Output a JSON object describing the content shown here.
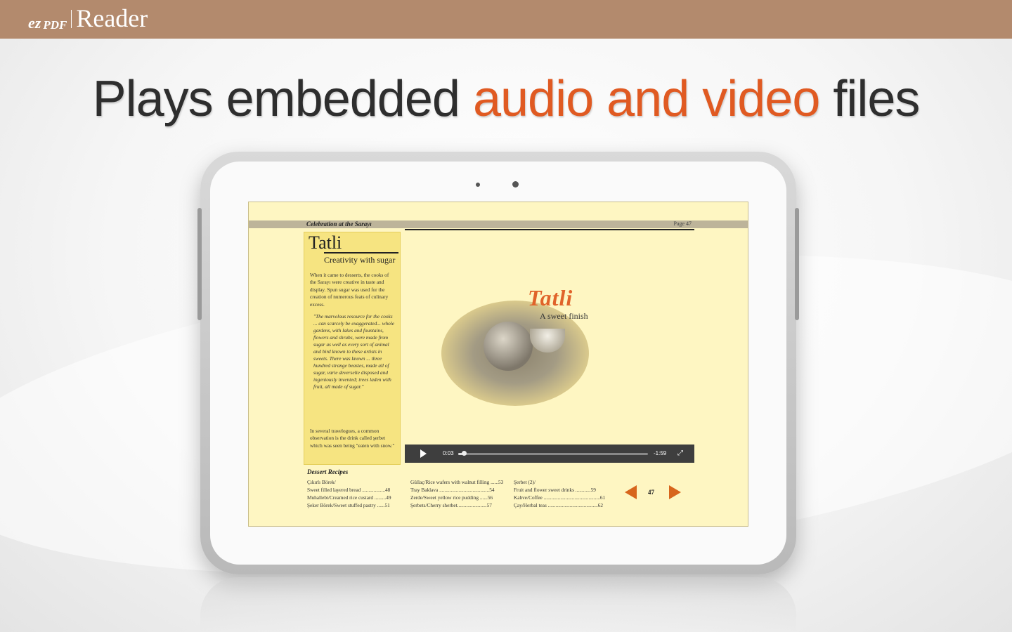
{
  "brand": {
    "ez": "ez",
    "pdf": "PDF",
    "reader": "Reader"
  },
  "headline": {
    "part1": "Plays embedded ",
    "accent": "audio and video",
    "part2": " files"
  },
  "colors": {
    "topbar": "#b38a6d",
    "accent": "#e05a22",
    "screen_bg": "#fef6c2"
  },
  "document": {
    "header_title": "Celebration at the Sarayı",
    "header_page": "Page 47",
    "panel": {
      "title": "Tatli",
      "subtitle": "Creativity with sugar",
      "intro": "When it came to desserts, the cooks of the Sarayı were creative in taste and display. Spun sugar was used for the creation of numerous feats of culinary excess.",
      "quote": "\"The marvelous resource for the cooks ... can scarcely be exaggerated... whole gardens, with lakes and fountains, flowers and shrubs, were made from sugar as well as every sort of animal and bird known to these artists in sweets. There was known ... three hundred strange beastes, made all of sugar, varie deverselie disposed and ingeniously invented; trees laden with fruit, all made of sugar.\"",
      "outro": "In several travelogues, a common observation is the drink called şerbet which was seen being \"eaten with snow.\""
    },
    "video": {
      "title": "Tatli",
      "subtitle": "A sweet finish",
      "current_time": "0:03",
      "remaining_time": "-1:59",
      "progress": 0.02
    },
    "recipes": {
      "title": "Dessert Recipes",
      "col1": [
        "Çıkırlı Börek/",
        "   Sweet filled layered bread ..................48",
        "Muhallebi/Creamed rice custard .........49",
        "Şeker Börek/Sweet stuffed pastry ......51"
      ],
      "col2": [
        "Güllaç/Rice wafers with walnut filling ......53",
        "Tray Baklava .......................................54",
        "Zerde/Sweet yellow rice pudding ......56",
        "Şerbets/Cherry sherbet.......................57"
      ],
      "col3": [
        "Şerbet (2)/",
        "   Fruit and flower sweet drinks ............59",
        "Kahve/Coffee ............................................61",
        "Çay/Herbal teas .......................................62"
      ]
    },
    "page_number": "47"
  }
}
